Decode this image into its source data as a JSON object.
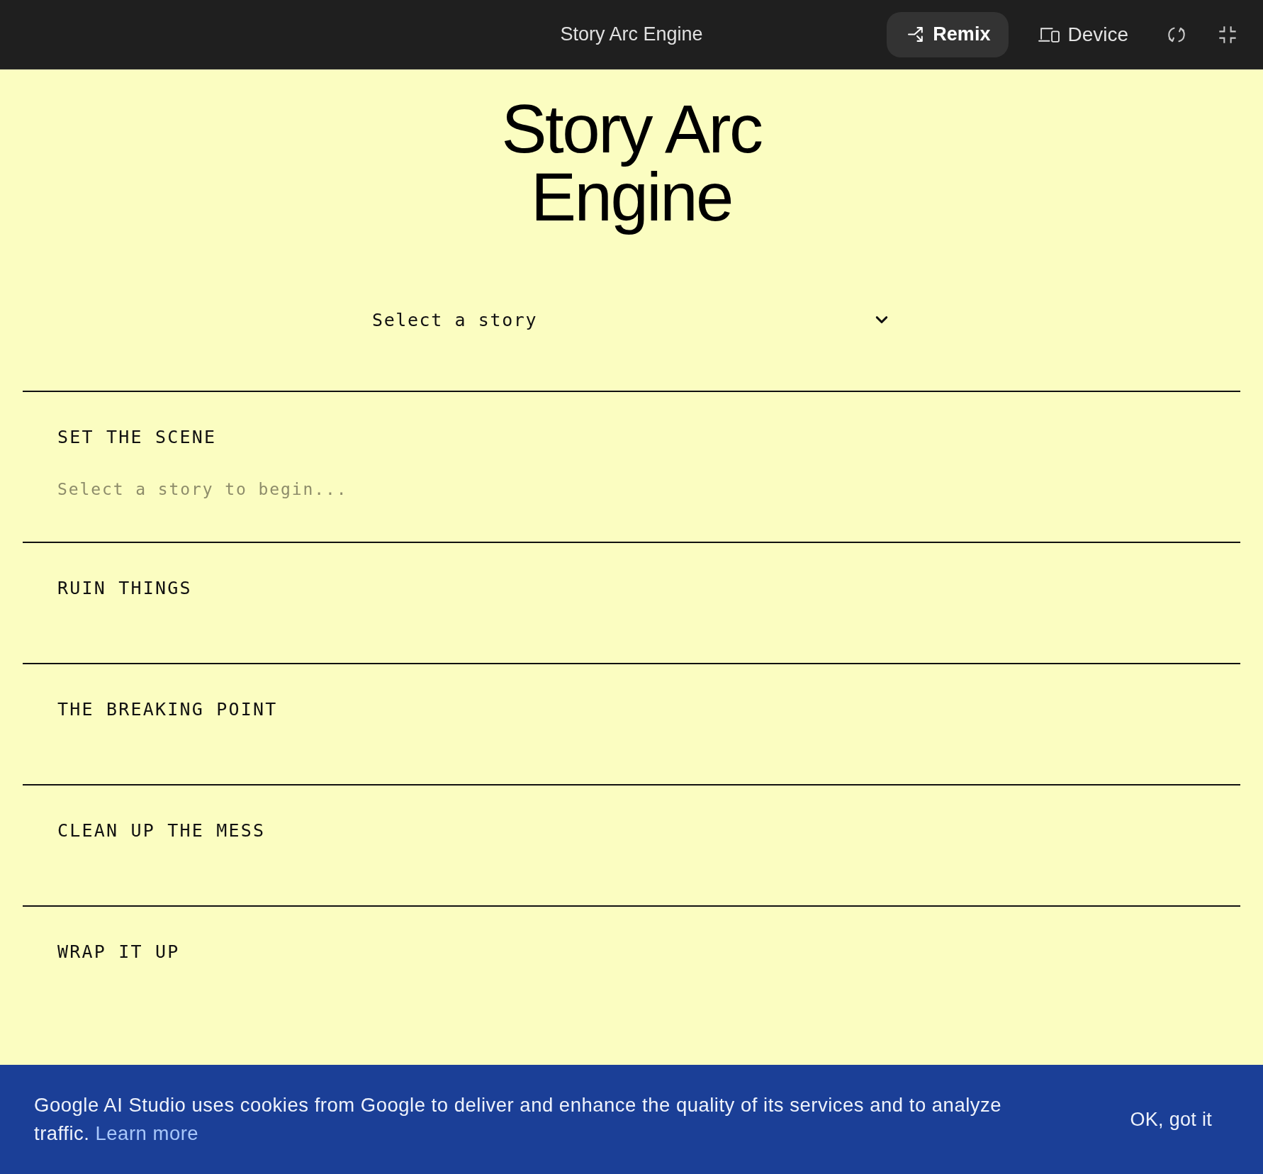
{
  "top_bar": {
    "title": "Story Arc Engine",
    "actions": [
      {
        "kind": "remix",
        "label": "Remix"
      },
      {
        "kind": "device",
        "label": "Device"
      },
      {
        "kind": "rotate"
      },
      {
        "kind": "collapse"
      }
    ]
  },
  "heading": "Story Arc Engine",
  "story_select": {
    "value": "Select a story"
  },
  "sections": [
    {
      "title": "SET THE SCENE",
      "text": "Select a story to begin..."
    },
    {
      "title": "RUIN THINGS"
    },
    {
      "title": "THE BREAKING POINT"
    },
    {
      "title": "CLEAN UP THE MESS"
    },
    {
      "title": "WRAP IT UP"
    }
  ],
  "cookie_banner": {
    "text": "Google AI Studio uses cookies from Google to deliver and enhance the quality of its services and to analyze traffic.",
    "link": "Learn more",
    "button": "OK, got it"
  }
}
